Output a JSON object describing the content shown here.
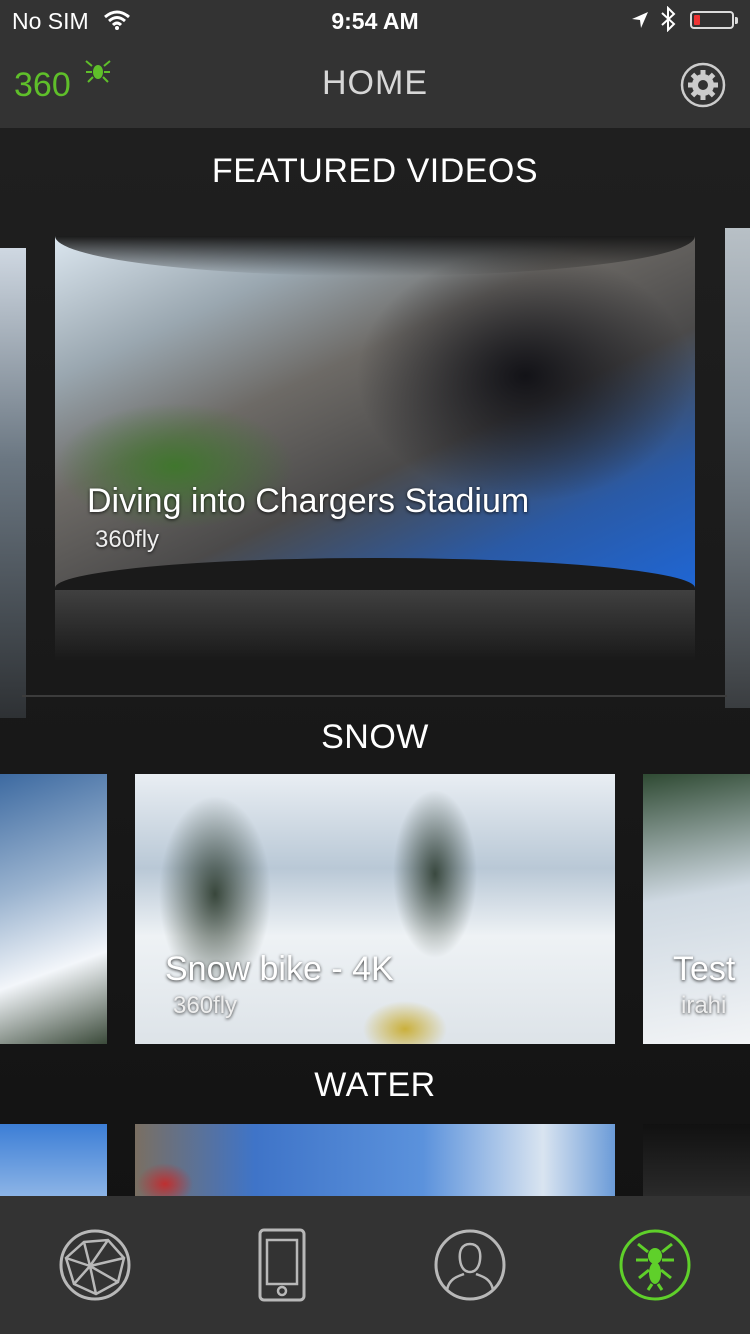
{
  "status_bar": {
    "carrier": "No SIM",
    "time": "9:54 AM",
    "icons": [
      "wifi-icon",
      "location-arrow-icon",
      "bluetooth-icon",
      "battery-low-icon"
    ],
    "battery_color": "#e33"
  },
  "nav": {
    "title": "HOME",
    "logo_text": "360",
    "logo_color": "#5fbf2a",
    "settings_icon": "gear-icon"
  },
  "featured": {
    "section_title": "FEATURED VIDEOS",
    "card": {
      "title": "Diving into Chargers Stadium",
      "author": "360fly"
    }
  },
  "snow": {
    "section_title": "SNOW",
    "cards": [
      {
        "title": "Snow bike - 4K",
        "author": "360fly"
      },
      {
        "title": "Test",
        "author": "irahi"
      }
    ]
  },
  "water": {
    "section_title": "WATER"
  },
  "tab_bar": {
    "items": [
      {
        "icon": "globe-explore-icon",
        "active": false
      },
      {
        "icon": "phone-device-icon",
        "active": false
      },
      {
        "icon": "profile-icon",
        "active": false
      },
      {
        "icon": "fly-home-icon",
        "active": true
      }
    ],
    "active_color": "#5fd02a",
    "inactive_color": "#b8b8b8"
  }
}
